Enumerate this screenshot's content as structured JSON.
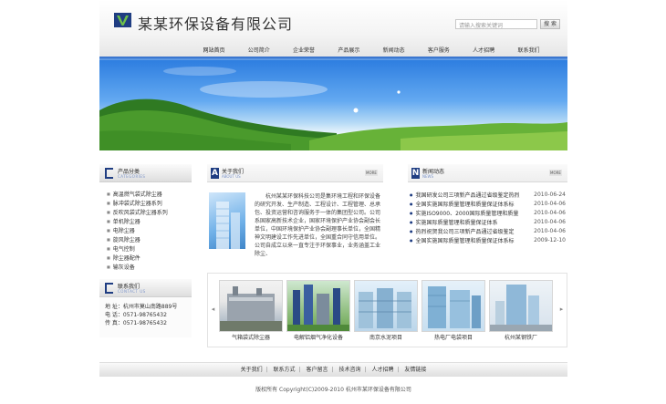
{
  "header": {
    "company_name": "某某环保设备有限公司",
    "search_placeholder": "请输入搜索关键词",
    "search_button": "搜 索"
  },
  "nav": {
    "items": [
      "网站首页",
      "公司简介",
      "企业荣誉",
      "产品展示",
      "新闻动态",
      "客户服务",
      "人才招聘",
      "联系我们"
    ]
  },
  "sidebar": {
    "category_title": "产品分类",
    "category_subtitle": "CATEGORIES",
    "categories": [
      "高温燃气袋式除尘器",
      "脉冲袋式除尘器系列",
      "反吹风袋式除尘器系列",
      "单机除尘器",
      "电除尘器",
      "旋风除尘器",
      "电气控制",
      "除尘器配件",
      "输灰设备"
    ],
    "contact_title": "联系我们",
    "contact_subtitle": "CONTACT US",
    "contact_lines": [
      "地  址：杭州市莫山南路889号",
      "电  话：0571-98765432",
      "传  真：0571-98765432"
    ]
  },
  "about": {
    "title": "关于我们",
    "subtitle": "ABOUT US",
    "more": "MORE",
    "text": "杭州某某环保科技公司是集环境工程和环保设备的研究开发、生产制造、工程设计、工程管理、总承包、投资运营和咨询服务于一体的集团型公司。公司系国家高新技术企业，国家环境保护产业协会副会长单位，中国环境保护产业协会副理事长单位，全国精神文明建设工作先进单位，全国重合同守信用单位。公司自成立以来一直专注于环保事业，业务涵盖工业除尘、"
  },
  "news": {
    "title": "新闻动态",
    "subtitle": "NEWS",
    "more": "MORE",
    "items": [
      {
        "title": "我国研发公司三项新产品通过省级鉴定热烈",
        "date": "2010-06-24"
      },
      {
        "title": "全国实施国际质量管理和质量保证体系标",
        "date": "2010-04-06"
      },
      {
        "title": "实施ISO9000、2000国际质量管理和质量",
        "date": "2010-04-06"
      },
      {
        "title": "实施国际质量管理和质量保证体系",
        "date": "2010-04-06"
      },
      {
        "title": "热烈祝贺我公司三项新产品通过省级鉴定",
        "date": "2010-04-06"
      },
      {
        "title": "全国实施国际质量管理和质量保证体系标",
        "date": "2009-12-10"
      }
    ]
  },
  "products": {
    "items": [
      {
        "caption": "气箱袋式除尘器"
      },
      {
        "caption": "电解铝烟气净化设备"
      },
      {
        "caption": "南京水泥项目"
      },
      {
        "caption": "热电厂电袋项目"
      },
      {
        "caption": "杭州某钢铁厂"
      }
    ]
  },
  "footer": {
    "links": [
      "关于我们",
      "联系方式",
      "客户留言",
      "技术咨询",
      "人才招聘",
      "友情链接"
    ],
    "separator": "|",
    "copyright": "版权所有 Copyright(C)2009-2010 杭州市某环保设备有限公司"
  },
  "colors": {
    "accent": "#1f3d82",
    "nav_bar": "#2a67c6"
  }
}
